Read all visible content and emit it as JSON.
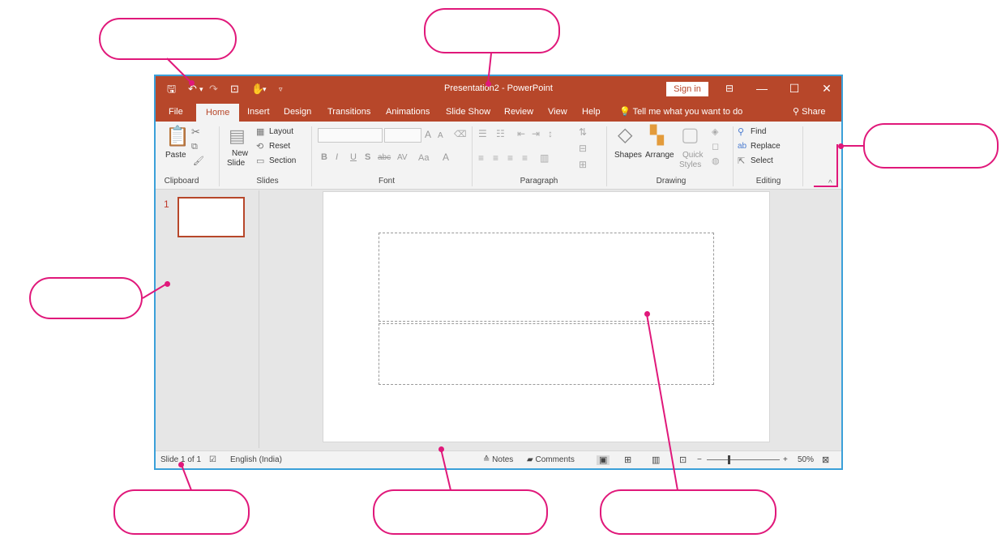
{
  "window": {
    "title": "Presentation2  -  PowerPoint",
    "sign_in": "Sign in"
  },
  "qat": {
    "save_icon": "save-icon",
    "undo_icon": "undo-icon",
    "redo_icon": "redo-icon",
    "present_icon": "present-icon",
    "touch_icon": "touch-mode-icon",
    "customize_icon": "customize-qat-icon"
  },
  "window_controls": {
    "ribbon_display_icon": "ribbon-display-icon",
    "minimize": "—",
    "maximize": "☐",
    "close": "✕"
  },
  "tabs": [
    {
      "label": "File"
    },
    {
      "label": "Home"
    },
    {
      "label": "Insert"
    },
    {
      "label": "Design"
    },
    {
      "label": "Transitions"
    },
    {
      "label": "Animations"
    },
    {
      "label": "Slide Show"
    },
    {
      "label": "Review"
    },
    {
      "label": "View"
    },
    {
      "label": "Help"
    }
  ],
  "tell_me": "Tell me what you want to do",
  "share": "Share",
  "ribbon": {
    "clipboard": {
      "paste": "Paste",
      "label": "Clipboard"
    },
    "slides": {
      "new_slide_1": "New",
      "new_slide_2": "Slide",
      "layout": "Layout",
      "reset": "Reset",
      "section": "Section",
      "label": "Slides"
    },
    "font": {
      "label": "Font",
      "bold": "B",
      "italic": "I",
      "underline": "U",
      "shadow": "S",
      "strike": "abc",
      "spacing": "AV",
      "case": "Aa",
      "color": "A",
      "grow": "A",
      "shrink": "A"
    },
    "paragraph": {
      "label": "Paragraph"
    },
    "drawing": {
      "shapes": "Shapes",
      "arrange": "Arrange",
      "quick_1": "Quick",
      "quick_2": "Styles",
      "label": "Drawing"
    },
    "editing": {
      "find": "Find",
      "replace": "Replace",
      "select": "Select",
      "label": "Editing"
    }
  },
  "thumbnails": [
    {
      "number": "1"
    }
  ],
  "status": {
    "slide": "Slide 1 of 1",
    "language": "English (India)",
    "notes": "Notes",
    "comments": "Comments",
    "zoom_minus": "−",
    "zoom_plus": "+",
    "zoom": "50%"
  },
  "colors": {
    "brand": "#b7472a",
    "callout": "#e0187a",
    "window_border": "#3ba0d9"
  }
}
